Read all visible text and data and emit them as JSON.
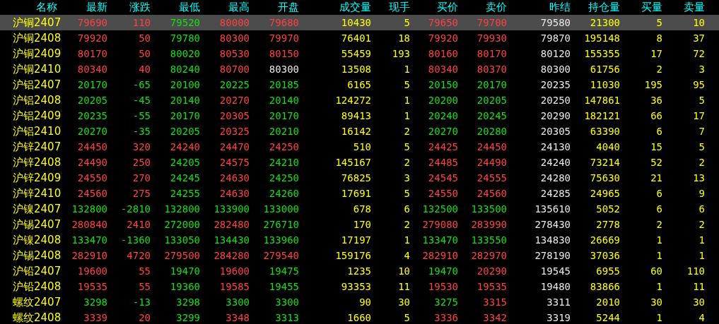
{
  "columns": [
    {
      "label": "名称",
      "kind": "name"
    },
    {
      "label": "最新",
      "kind": "price"
    },
    {
      "label": "涨跌",
      "kind": "price"
    },
    {
      "label": "最低",
      "kind": "price"
    },
    {
      "label": "最高",
      "kind": "price"
    },
    {
      "label": "开盘",
      "kind": "price"
    },
    {
      "label": "成交量",
      "kind": "volume"
    },
    {
      "label": "现手",
      "kind": "volume"
    },
    {
      "label": "买价",
      "kind": "price"
    },
    {
      "label": "卖价",
      "kind": "price"
    },
    {
      "label": "昨结",
      "kind": "settle"
    },
    {
      "label": "持仓量",
      "kind": "volume"
    },
    {
      "label": "买量",
      "kind": "volume"
    },
    {
      "label": "卖量",
      "kind": "volume"
    }
  ],
  "rows": [
    {
      "name": "沪铜2407",
      "selected": true,
      "cells": [
        {
          "value": "79690",
          "color": "#ff4040"
        },
        {
          "value": "110",
          "color": "#ff4040"
        },
        {
          "value": "79520",
          "color": "#10e010"
        },
        {
          "value": "80000",
          "color": "#ff4040"
        },
        {
          "value": "79680",
          "color": "#ff4040"
        },
        {
          "value": "10430"
        },
        {
          "value": "5"
        },
        {
          "value": "79650",
          "color": "#ff4040"
        },
        {
          "value": "79700",
          "color": "#ff4040"
        },
        {
          "value": "79580"
        },
        {
          "value": "21300"
        },
        {
          "value": "5"
        },
        {
          "value": "10"
        }
      ]
    },
    {
      "name": "沪铜2408",
      "selected": false,
      "cells": [
        {
          "value": "79920",
          "color": "#ff4040"
        },
        {
          "value": "50",
          "color": "#ff4040"
        },
        {
          "value": "79780",
          "color": "#10e010"
        },
        {
          "value": "80300",
          "color": "#ff4040"
        },
        {
          "value": "79970",
          "color": "#ff4040"
        },
        {
          "value": "76401"
        },
        {
          "value": "18"
        },
        {
          "value": "79920",
          "color": "#ff4040"
        },
        {
          "value": "79930",
          "color": "#ff4040"
        },
        {
          "value": "79870"
        },
        {
          "value": "195148"
        },
        {
          "value": "8"
        },
        {
          "value": "37"
        }
      ]
    },
    {
      "name": "沪铜2409",
      "selected": false,
      "cells": [
        {
          "value": "80170",
          "color": "#ff4040"
        },
        {
          "value": "50",
          "color": "#ff4040"
        },
        {
          "value": "80020",
          "color": "#10e010"
        },
        {
          "value": "80530",
          "color": "#ff4040"
        },
        {
          "value": "80150",
          "color": "#ff4040"
        },
        {
          "value": "55459"
        },
        {
          "value": "193"
        },
        {
          "value": "80160",
          "color": "#ff4040"
        },
        {
          "value": "80170",
          "color": "#ff4040"
        },
        {
          "value": "80120"
        },
        {
          "value": "155355"
        },
        {
          "value": "17"
        },
        {
          "value": "72"
        }
      ]
    },
    {
      "name": "沪铜2410",
      "selected": false,
      "cells": [
        {
          "value": "80340",
          "color": "#ff4040"
        },
        {
          "value": "40",
          "color": "#ff4040"
        },
        {
          "value": "80240",
          "color": "#10e010"
        },
        {
          "value": "80700",
          "color": "#ff4040"
        },
        {
          "value": "80300",
          "color": "#e8e8e8"
        },
        {
          "value": "13508"
        },
        {
          "value": "1"
        },
        {
          "value": "80340",
          "color": "#ff4040"
        },
        {
          "value": "80370",
          "color": "#ff4040"
        },
        {
          "value": "80300"
        },
        {
          "value": "61756"
        },
        {
          "value": "2"
        },
        {
          "value": "3"
        }
      ]
    },
    {
      "name": "沪铝2407",
      "selected": false,
      "cells": [
        {
          "value": "20170",
          "color": "#10e010"
        },
        {
          "value": "-65",
          "color": "#10e010"
        },
        {
          "value": "20100",
          "color": "#10e010"
        },
        {
          "value": "20225",
          "color": "#10e010"
        },
        {
          "value": "20185",
          "color": "#10e010"
        },
        {
          "value": "6165"
        },
        {
          "value": "5"
        },
        {
          "value": "20150",
          "color": "#10e010"
        },
        {
          "value": "20170",
          "color": "#10e010"
        },
        {
          "value": "20235"
        },
        {
          "value": "11030"
        },
        {
          "value": "195"
        },
        {
          "value": "95"
        }
      ]
    },
    {
      "name": "沪铝2408",
      "selected": false,
      "cells": [
        {
          "value": "20205",
          "color": "#10e010"
        },
        {
          "value": "-45",
          "color": "#10e010"
        },
        {
          "value": "20140",
          "color": "#10e010"
        },
        {
          "value": "20270",
          "color": "#ff4040"
        },
        {
          "value": "20140",
          "color": "#10e010"
        },
        {
          "value": "124272"
        },
        {
          "value": "1"
        },
        {
          "value": "20200",
          "color": "#10e010"
        },
        {
          "value": "20205",
          "color": "#10e010"
        },
        {
          "value": "20250"
        },
        {
          "value": "147861"
        },
        {
          "value": "36"
        },
        {
          "value": "5"
        }
      ]
    },
    {
      "name": "沪铝2409",
      "selected": false,
      "cells": [
        {
          "value": "20235",
          "color": "#10e010"
        },
        {
          "value": "-55",
          "color": "#10e010"
        },
        {
          "value": "20170",
          "color": "#10e010"
        },
        {
          "value": "20305",
          "color": "#ff4040"
        },
        {
          "value": "20170",
          "color": "#10e010"
        },
        {
          "value": "89413"
        },
        {
          "value": "1"
        },
        {
          "value": "20240",
          "color": "#10e010"
        },
        {
          "value": "20245",
          "color": "#10e010"
        },
        {
          "value": "20290"
        },
        {
          "value": "182121"
        },
        {
          "value": "66"
        },
        {
          "value": "17"
        }
      ]
    },
    {
      "name": "沪铝2410",
      "selected": false,
      "cells": [
        {
          "value": "20270",
          "color": "#10e010"
        },
        {
          "value": "-35",
          "color": "#10e010"
        },
        {
          "value": "20205",
          "color": "#10e010"
        },
        {
          "value": "20325",
          "color": "#ff4040"
        },
        {
          "value": "20210",
          "color": "#10e010"
        },
        {
          "value": "16142"
        },
        {
          "value": "2"
        },
        {
          "value": "20270",
          "color": "#10e010"
        },
        {
          "value": "20280",
          "color": "#10e010"
        },
        {
          "value": "20305"
        },
        {
          "value": "63390"
        },
        {
          "value": "6"
        },
        {
          "value": "7"
        }
      ]
    },
    {
      "name": "沪锌2407",
      "selected": false,
      "cells": [
        {
          "value": "24450",
          "color": "#ff4040"
        },
        {
          "value": "320",
          "color": "#ff4040"
        },
        {
          "value": "24240",
          "color": "#ff4040"
        },
        {
          "value": "24470",
          "color": "#ff4040"
        },
        {
          "value": "24250",
          "color": "#ff4040"
        },
        {
          "value": "510"
        },
        {
          "value": "5"
        },
        {
          "value": "24425",
          "color": "#ff4040"
        },
        {
          "value": "24450",
          "color": "#ff4040"
        },
        {
          "value": "24130"
        },
        {
          "value": "4040"
        },
        {
          "value": "15"
        },
        {
          "value": "5"
        }
      ]
    },
    {
      "name": "沪锌2408",
      "selected": false,
      "cells": [
        {
          "value": "24490",
          "color": "#ff4040"
        },
        {
          "value": "250",
          "color": "#ff4040"
        },
        {
          "value": "24205",
          "color": "#10e010"
        },
        {
          "value": "24575",
          "color": "#ff4040"
        },
        {
          "value": "24210",
          "color": "#10e010"
        },
        {
          "value": "145167"
        },
        {
          "value": "2"
        },
        {
          "value": "24485",
          "color": "#ff4040"
        },
        {
          "value": "24490",
          "color": "#ff4040"
        },
        {
          "value": "24240"
        },
        {
          "value": "73214"
        },
        {
          "value": "52"
        },
        {
          "value": "2"
        }
      ]
    },
    {
      "name": "沪锌2409",
      "selected": false,
      "cells": [
        {
          "value": "24550",
          "color": "#ff4040"
        },
        {
          "value": "270",
          "color": "#ff4040"
        },
        {
          "value": "24245",
          "color": "#10e010"
        },
        {
          "value": "24630",
          "color": "#ff4040"
        },
        {
          "value": "24250",
          "color": "#10e010"
        },
        {
          "value": "76825"
        },
        {
          "value": "3"
        },
        {
          "value": "24545",
          "color": "#ff4040"
        },
        {
          "value": "24555",
          "color": "#ff4040"
        },
        {
          "value": "24280"
        },
        {
          "value": "75630"
        },
        {
          "value": "21"
        },
        {
          "value": "13"
        }
      ]
    },
    {
      "name": "沪锌2410",
      "selected": false,
      "cells": [
        {
          "value": "24560",
          "color": "#ff4040"
        },
        {
          "value": "275",
          "color": "#ff4040"
        },
        {
          "value": "24255",
          "color": "#10e010"
        },
        {
          "value": "24630",
          "color": "#ff4040"
        },
        {
          "value": "24260",
          "color": "#10e010"
        },
        {
          "value": "17691"
        },
        {
          "value": "5"
        },
        {
          "value": "24550",
          "color": "#ff4040"
        },
        {
          "value": "24560",
          "color": "#ff4040"
        },
        {
          "value": "24285"
        },
        {
          "value": "24965"
        },
        {
          "value": "6"
        },
        {
          "value": "9"
        }
      ]
    },
    {
      "name": "沪镍2407",
      "selected": false,
      "cells": [
        {
          "value": "132800",
          "color": "#10e010"
        },
        {
          "value": "-2810",
          "color": "#10e010"
        },
        {
          "value": "132800",
          "color": "#10e010"
        },
        {
          "value": "133900",
          "color": "#10e010"
        },
        {
          "value": "133000",
          "color": "#10e010"
        },
        {
          "value": "678"
        },
        {
          "value": "6"
        },
        {
          "value": "132500",
          "color": "#10e010"
        },
        {
          "value": "133500",
          "color": "#10e010"
        },
        {
          "value": "135610"
        },
        {
          "value": "5052"
        },
        {
          "value": "6"
        },
        {
          "value": "6"
        }
      ]
    },
    {
      "name": "沪锡2407",
      "selected": false,
      "cells": [
        {
          "value": "280840",
          "color": "#ff4040"
        },
        {
          "value": "2410",
          "color": "#ff4040"
        },
        {
          "value": "272000",
          "color": "#10e010"
        },
        {
          "value": "282480",
          "color": "#ff4040"
        },
        {
          "value": "276710",
          "color": "#10e010"
        },
        {
          "value": "170"
        },
        {
          "value": "2"
        },
        {
          "value": "279080",
          "color": "#ff4040"
        },
        {
          "value": "283990",
          "color": "#ff4040"
        },
        {
          "value": "278430"
        },
        {
          "value": "2778"
        },
        {
          "value": "2"
        },
        {
          "value": "2"
        }
      ]
    },
    {
      "name": "沪镍2408",
      "selected": false,
      "cells": [
        {
          "value": "133470",
          "color": "#10e010"
        },
        {
          "value": "-1360",
          "color": "#10e010"
        },
        {
          "value": "133050",
          "color": "#10e010"
        },
        {
          "value": "134430",
          "color": "#10e010"
        },
        {
          "value": "133960",
          "color": "#10e010"
        },
        {
          "value": "17197"
        },
        {
          "value": "1"
        },
        {
          "value": "133470",
          "color": "#10e010"
        },
        {
          "value": "133550",
          "color": "#10e010"
        },
        {
          "value": "134830"
        },
        {
          "value": "26669"
        },
        {
          "value": "1"
        },
        {
          "value": "1"
        }
      ]
    },
    {
      "name": "沪锡2408",
      "selected": false,
      "cells": [
        {
          "value": "282910",
          "color": "#ff4040"
        },
        {
          "value": "4720",
          "color": "#ff4040"
        },
        {
          "value": "279500",
          "color": "#ff4040"
        },
        {
          "value": "284280",
          "color": "#ff4040"
        },
        {
          "value": "279540",
          "color": "#ff4040"
        },
        {
          "value": "159176"
        },
        {
          "value": "4"
        },
        {
          "value": "282910",
          "color": "#ff4040"
        },
        {
          "value": "282970",
          "color": "#ff4040"
        },
        {
          "value": "278190"
        },
        {
          "value": "37036"
        },
        {
          "value": "1"
        },
        {
          "value": "1"
        }
      ]
    },
    {
      "name": "沪铅2407",
      "selected": false,
      "cells": [
        {
          "value": "19600",
          "color": "#ff4040"
        },
        {
          "value": "55",
          "color": "#ff4040"
        },
        {
          "value": "19470",
          "color": "#10e010"
        },
        {
          "value": "19600",
          "color": "#ff4040"
        },
        {
          "value": "19475",
          "color": "#10e010"
        },
        {
          "value": "1235"
        },
        {
          "value": "10"
        },
        {
          "value": "19470",
          "color": "#10e010"
        },
        {
          "value": "20290",
          "color": "#ff4040"
        },
        {
          "value": "19545"
        },
        {
          "value": "6955"
        },
        {
          "value": "60"
        },
        {
          "value": "110"
        }
      ]
    },
    {
      "name": "沪铅2408",
      "selected": false,
      "cells": [
        {
          "value": "19535",
          "color": "#ff4040"
        },
        {
          "value": "55",
          "color": "#ff4040"
        },
        {
          "value": "19360",
          "color": "#10e010"
        },
        {
          "value": "19585",
          "color": "#ff4040"
        },
        {
          "value": "19455",
          "color": "#10e010"
        },
        {
          "value": "93353"
        },
        {
          "value": "11"
        },
        {
          "value": "19530",
          "color": "#ff4040"
        },
        {
          "value": "19535",
          "color": "#ff4040"
        },
        {
          "value": "19480"
        },
        {
          "value": "83866"
        },
        {
          "value": "1"
        },
        {
          "value": "11"
        }
      ]
    },
    {
      "name": "螺纹2407",
      "selected": false,
      "cells": [
        {
          "value": "3298",
          "color": "#10e010"
        },
        {
          "value": "-13",
          "color": "#10e010"
        },
        {
          "value": "3298",
          "color": "#10e010"
        },
        {
          "value": "3300",
          "color": "#10e010"
        },
        {
          "value": "3300",
          "color": "#10e010"
        },
        {
          "value": "90"
        },
        {
          "value": "30"
        },
        {
          "value": "3275",
          "color": "#10e010"
        },
        {
          "value": "3315",
          "color": "#ff4040"
        },
        {
          "value": "3311"
        },
        {
          "value": "2010"
        },
        {
          "value": "30"
        },
        {
          "value": "30"
        }
      ]
    },
    {
      "name": "螺纹2408",
      "selected": false,
      "cells": [
        {
          "value": "3339",
          "color": "#ff4040"
        },
        {
          "value": "20",
          "color": "#ff4040"
        },
        {
          "value": "3299",
          "color": "#10e010"
        },
        {
          "value": "3348",
          "color": "#ff4040"
        },
        {
          "value": "3313",
          "color": "#10e010"
        },
        {
          "value": "1660"
        },
        {
          "value": "5"
        },
        {
          "value": "3336",
          "color": "#ff4040"
        },
        {
          "value": "3342",
          "color": "#ff4040"
        },
        {
          "value": "3319"
        },
        {
          "value": "5244"
        },
        {
          "value": "1"
        },
        {
          "value": "4"
        }
      ]
    }
  ]
}
